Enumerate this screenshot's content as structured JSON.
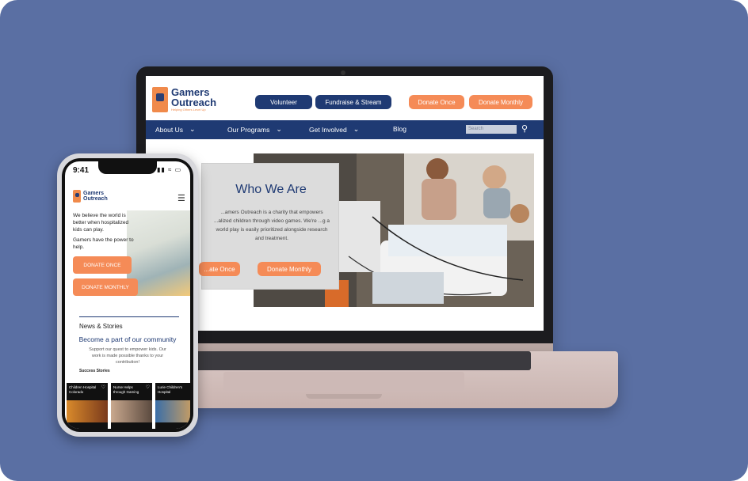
{
  "desktop": {
    "logo": {
      "name_line1": "Gamers",
      "name_line2": "Outreach",
      "tagline": "Helping Others Level Up"
    },
    "header_buttons": {
      "volunteer": "Volunteer",
      "fundraise": "Fundraise & Stream",
      "donate_once": "Donate Once",
      "donate_monthly": "Donate Monthly"
    },
    "nav": {
      "about": "About Us",
      "programs": "Our Programs",
      "involved": "Get Involved",
      "blog": "Blog",
      "search_placeholder": "Search"
    },
    "who_we_are": {
      "title": "Who We Are",
      "body": "...amers Outreach is a charity that empowers ...alized children through video games. We're ...g a world play is easily prioritized alongside research and treatment.",
      "donate_once": "...ate Once",
      "donate_monthly": "Donate Monthly"
    }
  },
  "mobile": {
    "time": "9:41",
    "logo": {
      "name_line1": "Gamers",
      "name_line2": "Outreach"
    },
    "hero_line1": "We believe the world is better when hospitalized kids can play.",
    "hero_line2": "Gamers have the power to help.",
    "donate_once": "DONATE ONCE",
    "donate_monthly": "DONATE MONTHLY",
    "news_heading": "News & Stories",
    "become": "Become a part of our community",
    "support": "Support our quest to empower kids. Our work is made possible thanks to your contribution!",
    "success_label": "Success Stories",
    "cards": [
      {
        "title": "Children Hospital Colorado"
      },
      {
        "title": "Nurse Helps through Gaming"
      },
      {
        "title": "Lurie Children's Hospital"
      }
    ]
  },
  "colors": {
    "navy": "#1f3a73",
    "orange": "#f58b57",
    "background": "#5a6fa3"
  }
}
